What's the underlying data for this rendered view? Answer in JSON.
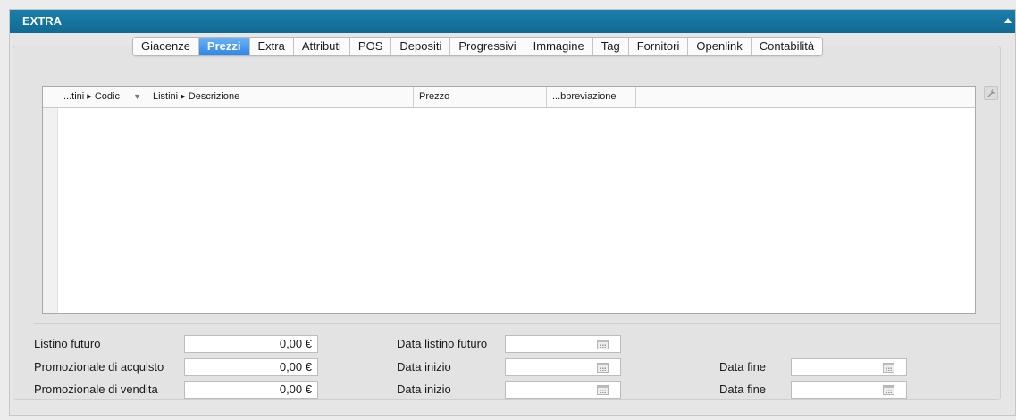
{
  "header": {
    "title": "EXTRA"
  },
  "tabs": [
    {
      "label": "Giacenze",
      "active": false
    },
    {
      "label": "Prezzi",
      "active": true
    },
    {
      "label": "Extra",
      "active": false
    },
    {
      "label": "Attributi",
      "active": false
    },
    {
      "label": "POS",
      "active": false
    },
    {
      "label": "Depositi",
      "active": false
    },
    {
      "label": "Progressivi",
      "active": false
    },
    {
      "label": "Immagine",
      "active": false
    },
    {
      "label": "Tag",
      "active": false
    },
    {
      "label": "Fornitori",
      "active": false
    },
    {
      "label": "Openlink",
      "active": false
    },
    {
      "label": "Contabilità",
      "active": false
    }
  ],
  "grid": {
    "columns": [
      {
        "label": "...tini ▸ Codic"
      },
      {
        "label": "Listini ▸ Descrizione"
      },
      {
        "label": "Prezzo"
      },
      {
        "label": "...bbreviazione"
      }
    ],
    "sort_icon": "sort-down-icon",
    "rows": []
  },
  "form": {
    "listino_futuro": {
      "label": "Listino futuro",
      "value": "0,00 €"
    },
    "promo_acquisto": {
      "label": "Promozionale di acquisto",
      "value": "0,00 €"
    },
    "promo_vendita": {
      "label": "Promozionale di vendita",
      "value": "0,00 €"
    },
    "data_listino_futuro": {
      "label": "Data listino futuro",
      "value": ""
    },
    "data_inizio_acquisto": {
      "label": "Data inizio",
      "value": ""
    },
    "data_inizio_vendita": {
      "label": "Data inizio",
      "value": ""
    },
    "data_fine_acquisto": {
      "label": "Data fine",
      "value": ""
    },
    "data_fine_vendita": {
      "label": "Data fine",
      "value": ""
    }
  },
  "colors": {
    "titlebar": "#147aa5",
    "tab_active": "#3d8fea"
  }
}
